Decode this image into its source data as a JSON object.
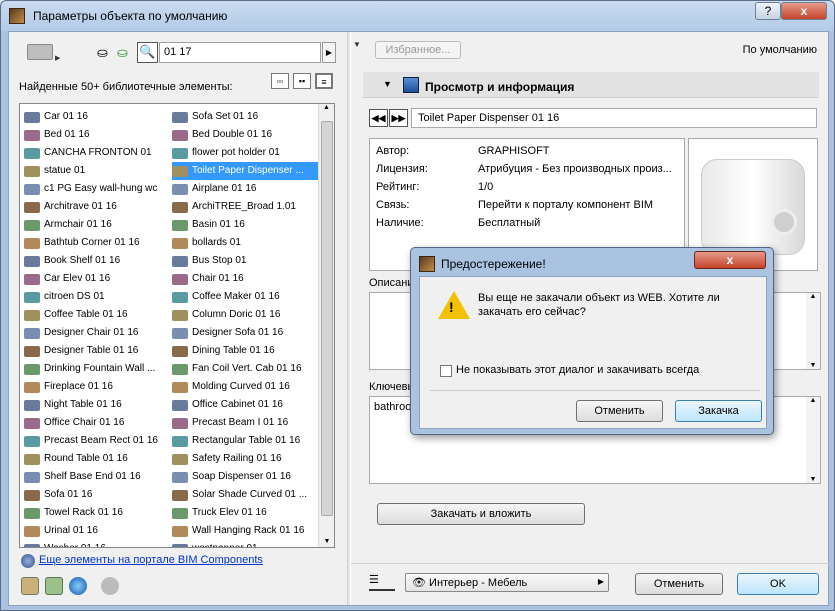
{
  "window": {
    "title": "Параметры объекта по умолчанию",
    "help": "?",
    "close": "x"
  },
  "left": {
    "search_value": "01 17",
    "found_label": "Найденные 50+ библиотечные элементы:",
    "col1": [
      "Car 01 16",
      "Bed 01 16",
      "CANCHA FRONTON 01",
      "statue 01",
      "c1 PG Easy wall-hung wc",
      "Architrave 01 16",
      "Armchair 01 16",
      "Bathtub Corner 01 16",
      "Book Shelf 01 16",
      "Car Elev 01 16",
      "citroen DS 01",
      "Coffee Table 01 16",
      "Designer Chair 01 16",
      "Designer Table 01 16",
      "Drinking Fountain Wall ...",
      "Fireplace 01 16",
      "Night Table 01 16",
      "Office Chair 01 16",
      "Precast Beam Rect 01 16",
      "Round Table 01 16",
      "Shelf Base End 01 16",
      "Sofa 01 16",
      "Towel Rack 01 16",
      "Urinal 01 16",
      "Washer 01 16"
    ],
    "col2": [
      "Sofa Set 01 16",
      "Bed Double 01 16",
      "flower pot holder 01",
      "Toilet Paper Dispenser ...",
      "Airplane 01 16",
      "ArchiTREE_Broad 1.01",
      "Basin 01 16",
      "bollards 01",
      "Bus Stop 01",
      "Chair 01 16",
      "Coffee Maker 01 16",
      "Column Doric 01 16",
      "Designer Sofa 01 16",
      "Dining Table 01 16",
      "Fan Coil Vert. Cab 01 16",
      "Molding Curved 01 16",
      "Office Cabinet 01 16",
      "Precast Beam I 01 16",
      "Rectangular Table 01 16",
      "Safety Railing 01 16",
      "Soap Dispenser 01 16",
      "Solar Shade Curved 01 ...",
      "Truck Elev 01 16",
      "Wall Hanging Rack 01 16",
      "westpanner 01"
    ],
    "selected_index_col2": 3,
    "more_link": "Еще элементы на портале BIM Components"
  },
  "right": {
    "favorites_btn": "Избранное...",
    "default_label": "По умолчанию",
    "section_title": "Просмотр и информация",
    "object_name": "Toilet Paper Dispenser 01 16",
    "info_rows": [
      {
        "k": "Автор:",
        "v": "GRAPHISOFT"
      },
      {
        "k": "Лицензия:",
        "v": "Атрибуция - Без производных произ..."
      },
      {
        "k": "Рейтинг:",
        "v": "1/0"
      },
      {
        "k": "Связь:",
        "v": "Перейти к порталу компонент BIM"
      },
      {
        "k": "Наличие:",
        "v": "Бесплатный"
      }
    ],
    "description_label": "Описани",
    "keywords_label": "Ключевы",
    "keywords_value": "bathroo",
    "download_btn": "Закачать и вложить",
    "layer_combo": "Интерьер - Мебель",
    "cancel_btn": "Отменить",
    "ok_btn": "OK"
  },
  "dialog": {
    "title": "Предостережение!",
    "close": "x",
    "message": "Вы еще не закачали объект из WEB. Хотите ли закачать его сейчас?",
    "checkbox_label": "Не показывать этот диалог и закачивать всегда",
    "cancel_btn": "Отменить",
    "download_btn": "Закачка"
  }
}
